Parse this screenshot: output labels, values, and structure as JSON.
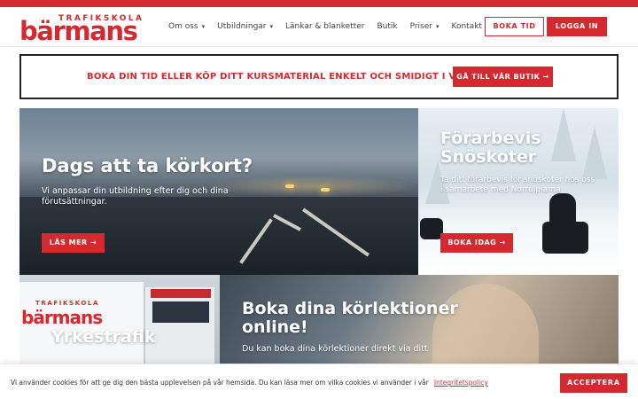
{
  "brand": {
    "tagline": "TRAFIKSKOLA",
    "name": "bärmans"
  },
  "nav": {
    "items": [
      {
        "label": "Om oss",
        "has_dropdown": true
      },
      {
        "label": "Utbildningar",
        "has_dropdown": true
      },
      {
        "label": "Länkar & blanketter",
        "has_dropdown": false
      },
      {
        "label": "Butik",
        "has_dropdown": false
      },
      {
        "label": "Priser",
        "has_dropdown": true
      },
      {
        "label": "Kontakt",
        "has_dropdown": false
      }
    ],
    "book_label": "BOKA TID",
    "login_label": "LOGGA IN"
  },
  "banner": {
    "text": "BOKA DIN TID ELLER KÖP DITT KURSMATERIAL ENKELT OCH SMIDIGT I VÅR BUTIK.",
    "button_label": "GÅ TILL VÅR BUTIK →"
  },
  "tiles": {
    "license": {
      "title": "Dags att ta körkort?",
      "subtitle": "Vi anpassar din utbildning efter dig och dina förutsättningar.",
      "button_label": "LÄS MER →"
    },
    "snowmobile": {
      "title": "Förarbevis Snöskoter",
      "subtitle": "Ta ditt förarbevis för snöskoter hos oss i samarbete med Norrulpiarna",
      "button_label": "BOKA IDAG →"
    },
    "truck": {
      "title": "Yrkestrafik",
      "truck_brand": "bärmans",
      "truck_tagline": "TRAFIKSKOLA"
    },
    "online": {
      "title": "Boka dina körlektioner online!",
      "subtitle": "Du kan boka dina körlektioner direkt via ditt"
    }
  },
  "cookie": {
    "text": "Vi använder cookies för att ge dig den bästa upplevelsen på vår hemsida. Du kan läsa mer om vilka cookies vi använder i vår",
    "link_label": "Integritetspolicy",
    "accept_label": "ACCEPTERA"
  },
  "colors": {
    "brand_red": "#d42a2f",
    "text_dark": "#333333"
  }
}
